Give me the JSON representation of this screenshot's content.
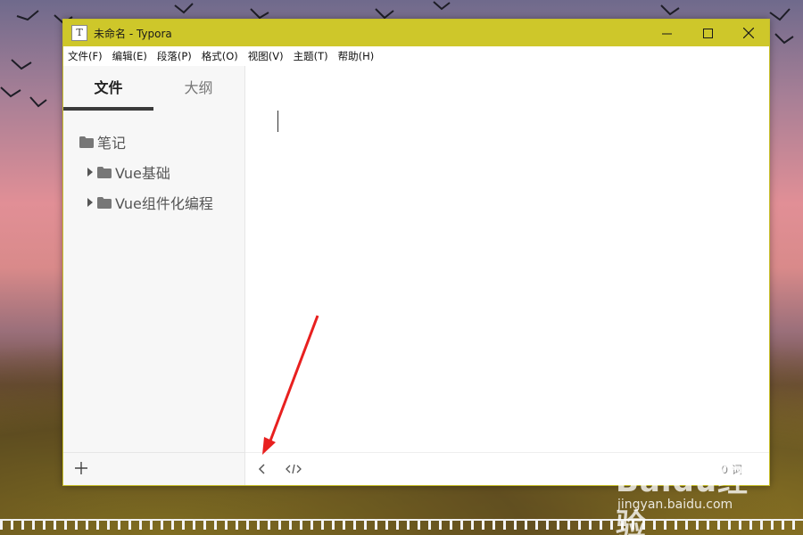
{
  "window": {
    "title": "未命名 - Typora",
    "controls": {
      "minimize": "minimize",
      "maximize": "maximize",
      "close": "close"
    }
  },
  "menu": {
    "items": [
      "文件(F)",
      "编辑(E)",
      "段落(P)",
      "格式(O)",
      "视图(V)",
      "主题(T)",
      "帮助(H)"
    ]
  },
  "sidebar": {
    "tabs": [
      "文件",
      "大纲"
    ],
    "active_tab": "文件",
    "tree": {
      "root": "笔记",
      "children": [
        "Vue基础",
        "Vue组件化编程"
      ]
    }
  },
  "statusbar": {
    "word_count": "0 词"
  },
  "watermark": {
    "logo": "Baidu经验",
    "site": "jingyan.baidu.com"
  },
  "colors": {
    "titlebar": "#cec72a",
    "arrow": "#e8201f"
  }
}
